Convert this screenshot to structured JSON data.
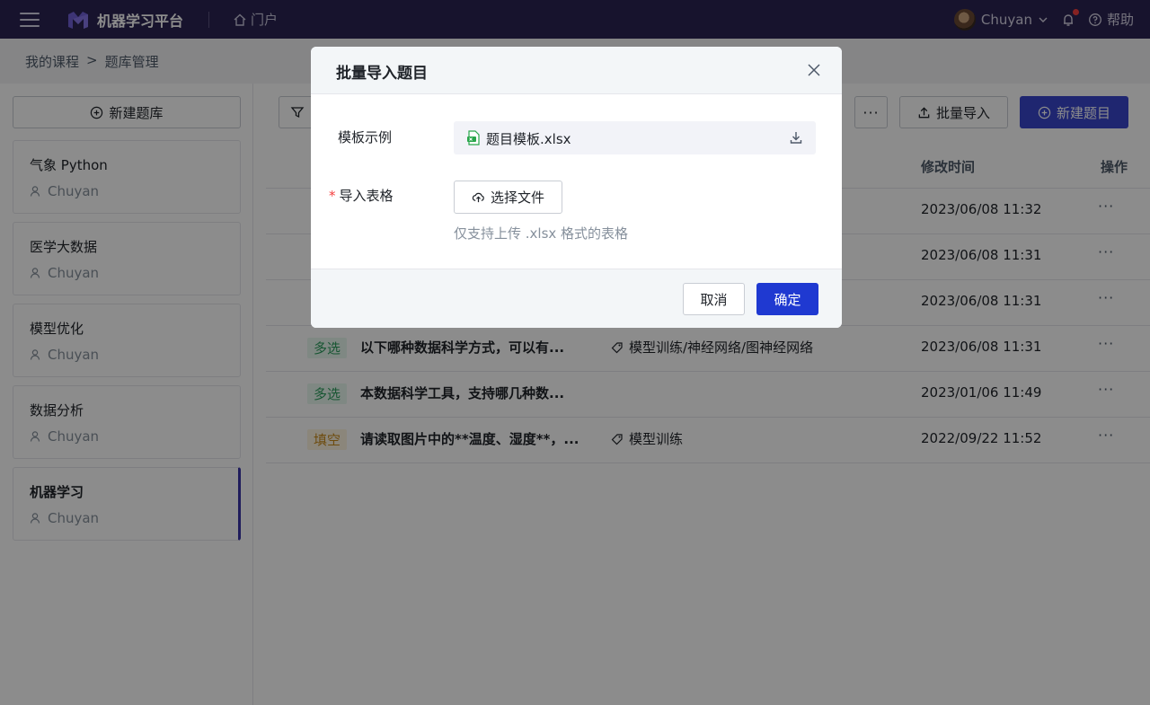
{
  "header": {
    "app_title": "机器学习平台",
    "portal_label": "门户",
    "user_name": "Chuyan",
    "help_label": "帮助"
  },
  "breadcrumb": {
    "items": [
      "我的课程",
      "题库管理"
    ],
    "separator": ">"
  },
  "sidebar": {
    "new_bank_label": "新建题库",
    "banks": [
      {
        "name": "气象 Python",
        "owner": "Chuyan",
        "active": false
      },
      {
        "name": "医学大数据",
        "owner": "Chuyan",
        "active": false
      },
      {
        "name": "模型优化",
        "owner": "Chuyan",
        "active": false
      },
      {
        "name": "数据分析",
        "owner": "Chuyan",
        "active": false
      },
      {
        "name": "机器学习",
        "owner": "Chuyan",
        "active": true
      }
    ]
  },
  "toolbar": {
    "more_label": "···",
    "import_label": "批量导入",
    "new_question_label": "新建题目"
  },
  "table": {
    "columns": {
      "modified": "修改时间",
      "actions": "操作"
    },
    "rows": [
      {
        "type": "",
        "title": "",
        "knowledge": "",
        "time": "2023/06/08 11:32"
      },
      {
        "type": "",
        "title": "",
        "knowledge": "",
        "time": "2023/06/08 11:31"
      },
      {
        "type": "",
        "title": "",
        "knowledge": "",
        "time": "2023/06/08 11:31"
      },
      {
        "type": "多选",
        "title": "以下哪种数据科学方式，可以有...",
        "knowledge": "模型训练/神经网络/图神经网络",
        "time": "2023/06/08 11:31"
      },
      {
        "type": "多选",
        "title": "本数据科学工具，支持哪几种数...",
        "knowledge": "",
        "time": "2023/01/06 11:49"
      },
      {
        "type": "填空",
        "title": "请读取图片中的**温度、湿度**，...",
        "knowledge": "模型训练",
        "time": "2022/09/22 11:52"
      }
    ],
    "ops_label": "···"
  },
  "modal": {
    "title": "批量导入题目",
    "template_label": "模板示例",
    "template_file": "题目模板.xlsx",
    "import_label": "导入表格",
    "required_mark": "*",
    "choose_file_label": "选择文件",
    "hint": "仅支持上传 .xlsx 格式的表格",
    "cancel_label": "取消",
    "confirm_label": "确定"
  },
  "colors": {
    "topbar": "#2a2452",
    "primary": "#1f39d1",
    "multi_tag": "#2d9d5e",
    "fill_tag": "#c98a1b"
  },
  "icons": [
    "menu-icon",
    "logo-icon",
    "home-icon",
    "chevron-down-icon",
    "bell-icon",
    "help-icon",
    "plus-circle-icon",
    "user-icon",
    "filter-icon",
    "upload-icon",
    "tag-icon",
    "excel-file-icon",
    "download-icon",
    "cloud-upload-icon",
    "close-icon"
  ]
}
